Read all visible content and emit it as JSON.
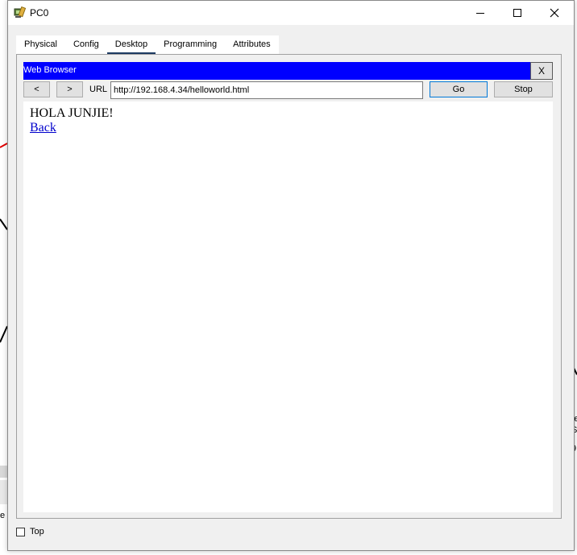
{
  "window": {
    "title": "PC0",
    "icon": "pc-device-icon",
    "controls": [
      "minimize",
      "maximize",
      "close"
    ]
  },
  "tabs": [
    {
      "label": "Physical",
      "active": false
    },
    {
      "label": "Config",
      "active": false
    },
    {
      "label": "Desktop",
      "active": true
    },
    {
      "label": "Programming",
      "active": false
    },
    {
      "label": "Attributes",
      "active": false
    }
  ],
  "web_browser": {
    "title": "Web Browser",
    "close_label": "X",
    "back_label": "<",
    "forward_label": ">",
    "url_label": "URL",
    "url_value": "http://192.168.4.34/helloworld.html",
    "go_label": "Go",
    "stop_label": "Stop",
    "page": {
      "heading": "HOLA JUNJIE!",
      "link_text": "Back"
    }
  },
  "footer": {
    "top_label": "Top",
    "top_checked": false
  },
  "background_fragments": [
    "e",
    "Se",
    "S",
    "9"
  ],
  "colors": {
    "browser_header": "#0000ff",
    "active_tab_underline": "#1c3a62",
    "link": "#0000cc",
    "go_button_border": "#0078d7"
  }
}
